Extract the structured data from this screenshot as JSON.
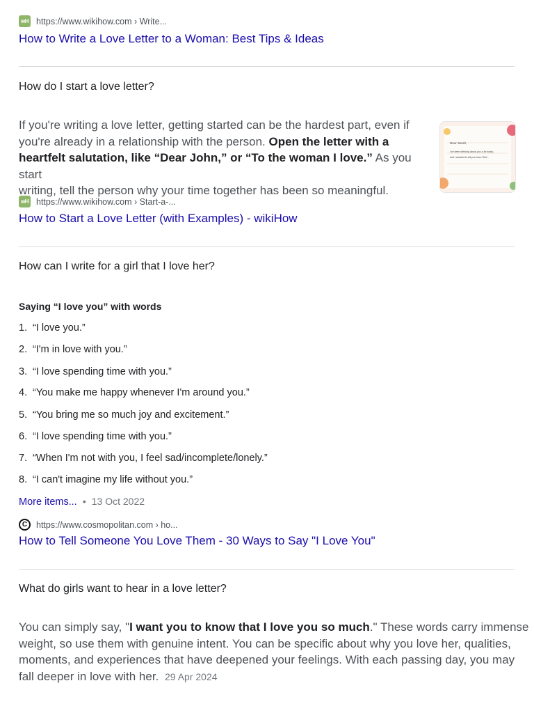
{
  "results": [
    {
      "source_url": "https://www.wikihow.com › Write...",
      "favicon": "wikihow-icon",
      "favicon_text": "wH",
      "title": "How to Write a Love Letter to a Woman: Best Tips & Ideas"
    }
  ],
  "qa": [
    {
      "question": "How do I start a love letter?",
      "answer_lines": [
        {
          "plain": "If you're writing a love letter, getting started can be the hardest part, even if"
        },
        {
          "plain": "you're already in a relationship with the person. ",
          "bold": "Open the letter with a"
        },
        {
          "bold": "heartfelt salutation, like “Dear John,” or “To the woman I love.”",
          "plain_after": " As you start"
        },
        {
          "plain": "writing, tell the person why your time together has been so meaningful."
        }
      ],
      "thumbnail": {
        "line1": "Dear Sarah,",
        "line2": "I've been thinking about you a lot today,",
        "line3": "and I wanted to tell you how I feel..."
      },
      "source_url": "https://www.wikihow.com › Start-a-...",
      "favicon": "wikihow-icon",
      "favicon_text": "wH",
      "link_title": "How to Start a Love Letter (with Examples) - wikiHow"
    },
    {
      "question": "How can I write for a girl that I love her?",
      "list_heading": "Saying “I love you” with words",
      "items": [
        {
          "num": "1.",
          "text": "“I love you.”"
        },
        {
          "num": "2.",
          "text": "“I'm in love with you.”"
        },
        {
          "num": "3.",
          "text": "“I love spending time with you.”"
        },
        {
          "num": "4.",
          "text": "“You make me happy whenever I'm around you.”"
        },
        {
          "num": "5.",
          "text": "“You bring me so much joy and excitement.”"
        },
        {
          "num": "6.",
          "text": "“I love spending time with you.”"
        },
        {
          "num": "7.",
          "text": "“When I'm not with you, I feel sad/incomplete/lonely.”"
        },
        {
          "num": "8.",
          "text": "“I can't imagine my life without you.”"
        }
      ],
      "more_items": "More items...",
      "separator": "•",
      "date": "13 Oct 2022",
      "source_url": "https://www.cosmopolitan.com › ho...",
      "favicon": "cosmopolitan-icon",
      "favicon_text": "C",
      "link_title": "How to Tell Someone You Love Them - 30 Ways to Say \"I Love You\""
    },
    {
      "question": "What do girls want to hear in a love letter?",
      "answer_lines": [
        {
          "plain": "You can simply say, \"",
          "bold": "I want you to know that I love you so much",
          "plain_after": ".\" These words carry immense"
        },
        {
          "plain": "weight, so use them with genuine intent. You can be specific about why you love her, qualities,"
        },
        {
          "plain": "moments, and experiences that have deepened your feelings. With each passing day, you may"
        },
        {
          "plain": "fall deeper in love with her. "
        }
      ],
      "date": "29 Apr 2024"
    }
  ],
  "colors": {
    "link": "#1a0dab",
    "divider": "#dadce0",
    "muted": "#4d5156"
  }
}
